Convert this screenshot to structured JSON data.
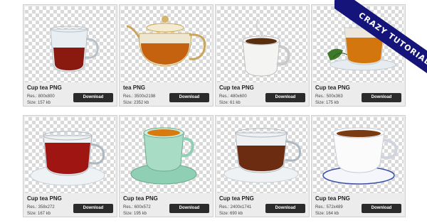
{
  "ribbon": {
    "text": "CRAZY TUTORIAL"
  },
  "download_label": "Download",
  "cards": [
    {
      "title": "Cup tea PNG",
      "res": "Res.: 800x800",
      "size": "Size: 157 kb"
    },
    {
      "title": "tea PNG",
      "res": "Res.: 3500x2198",
      "size": "Size: 2352 kb"
    },
    {
      "title": "Cup tea PNG",
      "res": "Res.: 480x600",
      "size": "Size: 61 kb"
    },
    {
      "title": "Cup tea PNG",
      "res": "Res.: 500x363",
      "size": "Size: 175 kb"
    },
    {
      "title": "Cup tea PNG",
      "res": "Res.: 358x272",
      "size": "Size: 167 kb"
    },
    {
      "title": "Cup tea PNG",
      "res": "Res.: 600x572",
      "size": "Size: 195 kb"
    },
    {
      "title": "Cup tea PNG",
      "res": "Res.: 2400x1741",
      "size": "Size: 690 kb"
    },
    {
      "title": "Cup tea PNG",
      "res": "Res.: 572x489",
      "size": "Size: 164 kb"
    }
  ]
}
